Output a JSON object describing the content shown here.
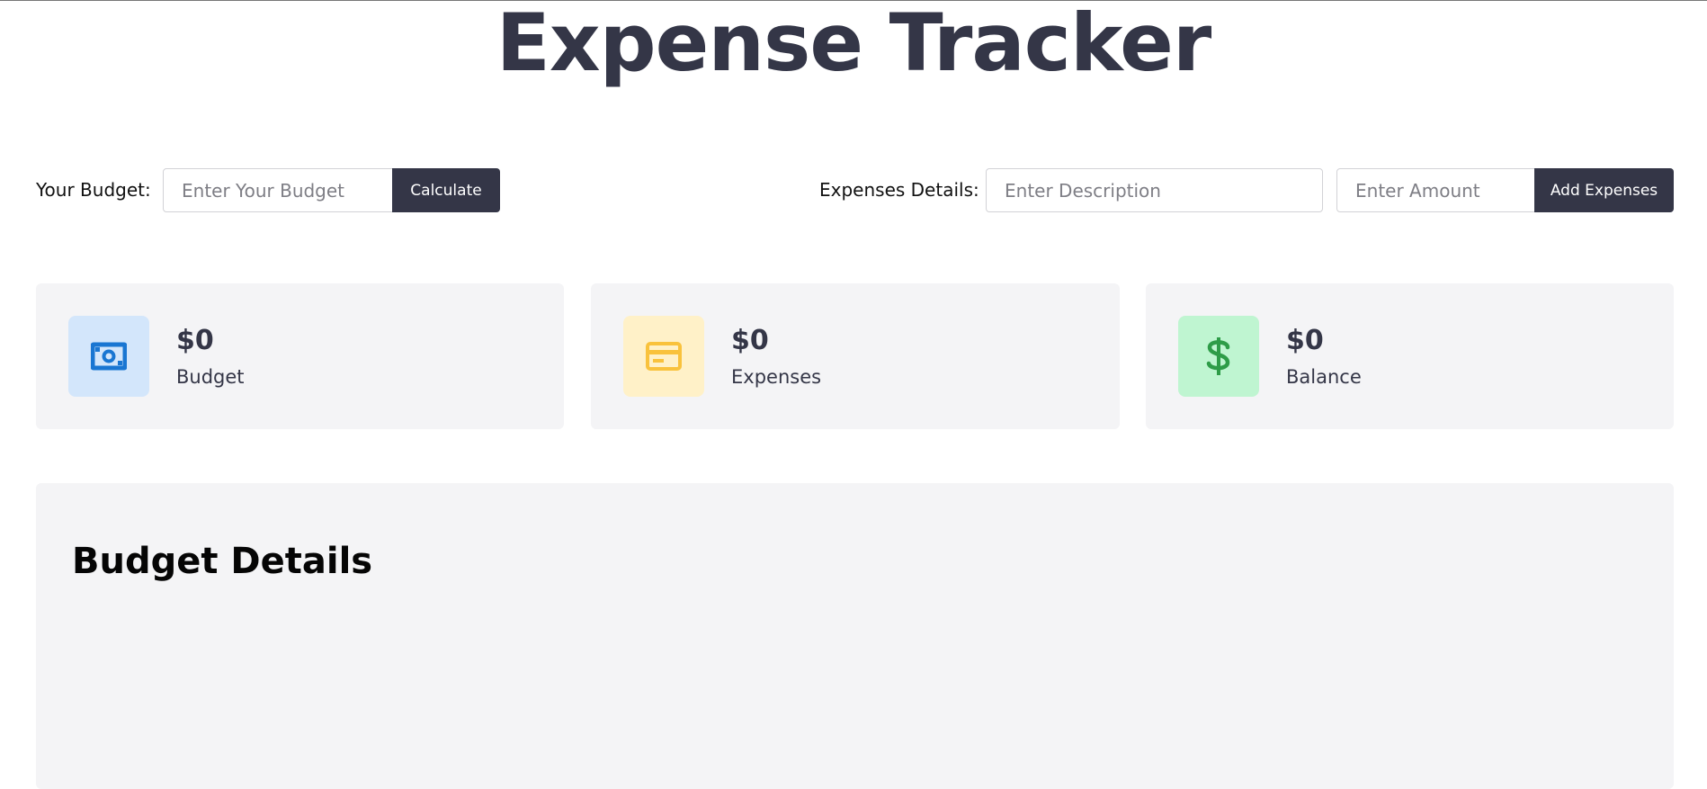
{
  "header": {
    "title": "Expense Tracker"
  },
  "budget_form": {
    "label": "Your Budget:",
    "placeholder": "Enter Your Budget",
    "value": "",
    "button": "Calculate"
  },
  "expense_form": {
    "label": "Expenses Details:",
    "description_placeholder": "Enter Description",
    "amount_placeholder": "Enter Amount",
    "button": "Add Expenses"
  },
  "stats": [
    {
      "value": "$0",
      "label": "Budget",
      "icon": "money-bill-icon",
      "icon_color": "#1976d2",
      "bg": "#d3e6fb"
    },
    {
      "value": "$0",
      "label": "Expenses",
      "icon": "credit-card-icon",
      "icon_color": "#f9c23c",
      "bg": "#fff1c8"
    },
    {
      "value": "$0",
      "label": "Balance",
      "icon": "dollar-icon",
      "icon_color": "#2e9c48",
      "bg": "#bff5d1"
    }
  ],
  "details": {
    "title": "Budget Details"
  },
  "colors": {
    "accent": "#343647",
    "panel": "#f4f4f6"
  }
}
